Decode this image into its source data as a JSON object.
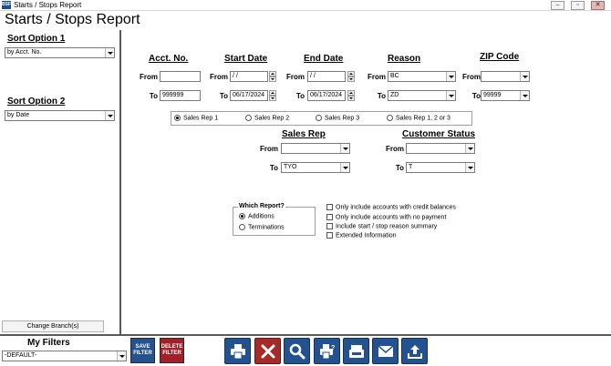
{
  "window": {
    "app_icon": "app-logo-icon",
    "title": "Starts / Stops Report",
    "minimize_glyph": "‒",
    "restore_glyph": "▫",
    "close_glyph": "✕"
  },
  "page_title": "Starts / Stops Report",
  "sort_option_1": {
    "label": "Sort Option 1",
    "value": "by Acct. No."
  },
  "sort_option_2": {
    "label": "Sort Option 2",
    "value": "by Date"
  },
  "filters": {
    "from_label": "From",
    "to_label": "To",
    "acct_no": {
      "header": "Acct. No.",
      "from": "",
      "to": "999999"
    },
    "start_date": {
      "header": "Start Date",
      "from": " / /",
      "to": "06/17/2024"
    },
    "end_date": {
      "header": "End Date",
      "from": " / /",
      "to": "06/17/2024"
    },
    "reason": {
      "header": "Reason",
      "from": "BC",
      "to": "ZD"
    },
    "zip_code": {
      "header": "ZIP Code",
      "from": "",
      "to": "99999"
    }
  },
  "sales_rep_radios": [
    {
      "label": "Sales Rep 1",
      "selected": true
    },
    {
      "label": "Sales Rep 2",
      "selected": false
    },
    {
      "label": "Sales Rep 3",
      "selected": false
    },
    {
      "label": "Sales Rep 1, 2 or 3",
      "selected": false
    }
  ],
  "sales_rep": {
    "header": "Sales Rep",
    "from": "",
    "to": "TYO"
  },
  "customer_status": {
    "header": "Customer Status",
    "from": "",
    "to": "T"
  },
  "which_report": {
    "title": "Which Report?",
    "options": [
      {
        "label": "Additions",
        "selected": true
      },
      {
        "label": "Terminations",
        "selected": false
      }
    ]
  },
  "checkboxes": [
    {
      "label": "Only include accounts with credit balances",
      "checked": false
    },
    {
      "label": "Only include accounts with no payment",
      "checked": false
    },
    {
      "label": "Include start / stop reason summary",
      "checked": false
    },
    {
      "label": "Extended Information",
      "checked": false
    }
  ],
  "change_branch_label": "Change Branch(s)",
  "my_filters": {
    "label": "My Filters",
    "value": "-DEFAULT-"
  },
  "save_filter": {
    "line1": "SAVE",
    "line2": "FILTER",
    "color": "#24528f"
  },
  "delete_filter": {
    "line1": "DELETE",
    "line2": "FILTER",
    "color": "#a3202b"
  },
  "toolbar_icons": [
    "print-icon",
    "cancel-icon",
    "preview-icon",
    "print-options-icon",
    "fax-icon",
    "email-icon",
    "export-icon"
  ],
  "colors": {
    "accent_blue": "#24528f",
    "delete_red": "#a3202b",
    "cancel_red": "#a62a2a"
  }
}
